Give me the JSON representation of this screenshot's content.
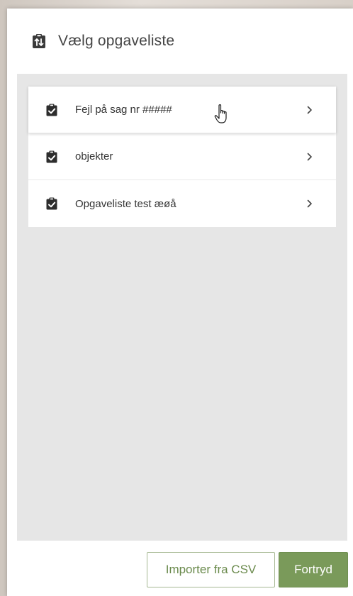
{
  "dialog": {
    "title": "Vælg opgaveliste",
    "title_icon": "clipboard-swap-icon"
  },
  "list": {
    "items": [
      {
        "label": "Fejl på sag nr #####",
        "icon": "clipboard-check-icon"
      },
      {
        "label": "objekter",
        "icon": "clipboard-check-icon"
      },
      {
        "label": "Opgaveliste test æøå",
        "icon": "clipboard-check-icon"
      }
    ]
  },
  "footer": {
    "import_label": "Importer fra CSV",
    "cancel_label": "Fortryd"
  },
  "colors": {
    "accent": "#7a9a5a",
    "panel_bg": "#e6e6e6",
    "text": "#333333"
  }
}
